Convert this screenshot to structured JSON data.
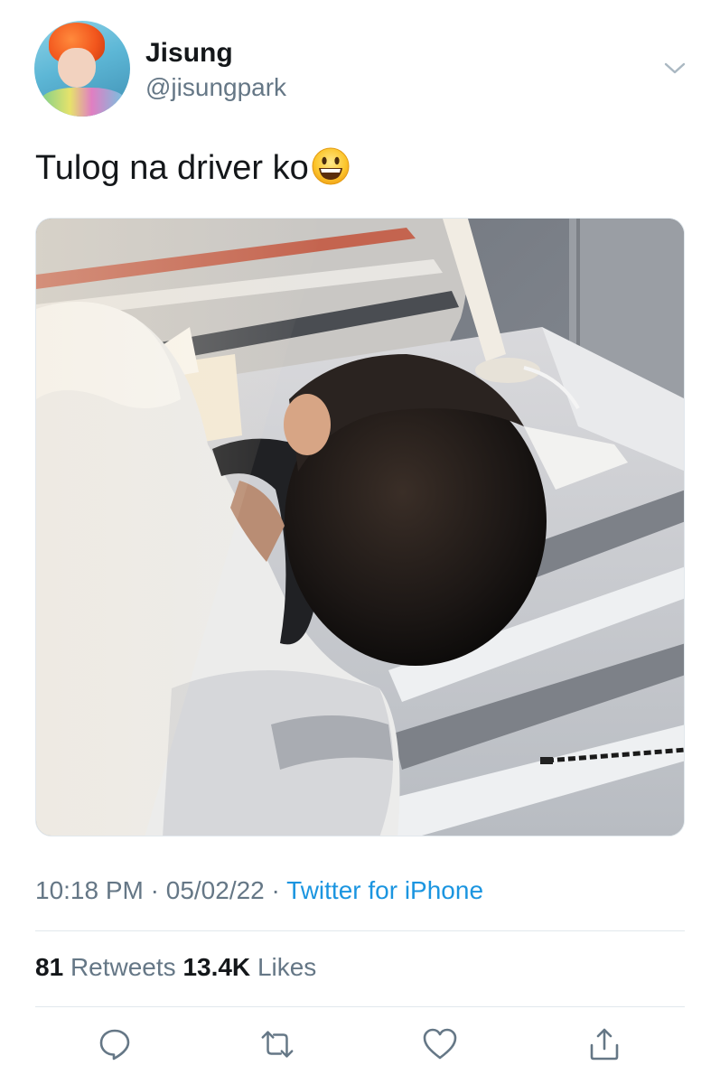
{
  "author": {
    "display_name": "Jisung",
    "handle": "@jisungpark"
  },
  "tweet": {
    "text": "Tulog na driver ko",
    "emoji": "grinning-face-emoji"
  },
  "meta": {
    "time": "10:18 PM",
    "date": "05/02/22",
    "separator": "·",
    "source": "Twitter for iPhone"
  },
  "stats": {
    "retweets_count": "81",
    "retweets_label": "Retweets",
    "likes_count": "13.4K",
    "likes_label": "Likes"
  },
  "actions": [
    {
      "name": "reply",
      "icon": "speech-bubble-icon"
    },
    {
      "name": "retweet",
      "icon": "retweet-arrows-icon"
    },
    {
      "name": "like",
      "icon": "heart-icon"
    },
    {
      "name": "share",
      "icon": "share-upload-icon"
    }
  ],
  "colors": {
    "text_primary": "#14171a",
    "text_secondary": "#657786",
    "link_blue": "#1b95e0",
    "divider": "#e1e8ed"
  }
}
